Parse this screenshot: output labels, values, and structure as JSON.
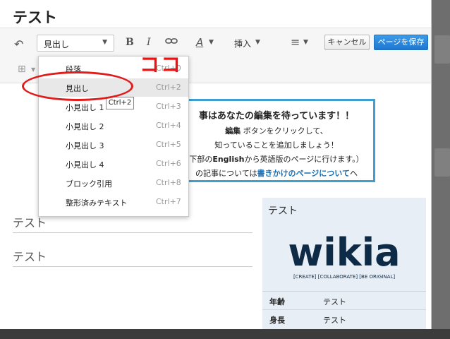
{
  "page": {
    "title": "テスト"
  },
  "toolbar": {
    "format_value": "見出し",
    "insert_label": "挿入",
    "cancel_label": "キャンセル",
    "save_label": "ページを保存"
  },
  "format_menu": {
    "items": [
      {
        "label": "段落",
        "shortcut": "Ctrl+0"
      },
      {
        "label": "見出し",
        "shortcut": "Ctrl+2"
      },
      {
        "label": "小見出し 1",
        "shortcut": "Ctrl+3"
      },
      {
        "label": "小見出し 2",
        "shortcut": "Ctrl+4"
      },
      {
        "label": "小見出し 3",
        "shortcut": "Ctrl+5"
      },
      {
        "label": "小見出し 4",
        "shortcut": "Ctrl+6"
      },
      {
        "label": "ブロック引用",
        "shortcut": "Ctrl+8"
      },
      {
        "label": "整形済みテキスト",
        "shortcut": "Ctrl+7"
      }
    ],
    "selected": "見出し",
    "tooltip": "Ctrl+2"
  },
  "annotation": {
    "text": "ココ",
    "color": "#ee1111"
  },
  "notice": {
    "line1": "事はあなたの編集を待っています！！",
    "line2_bold": "編集",
    "line2_rest": "ボタンをクリックして、",
    "line3": "知っていることを追加しましょう！",
    "line4_pre": "下部の",
    "line4_bold": "English",
    "line4_post": "から英語版のページに行けます。）",
    "line5_pre": "の記事については",
    "line5_link": "書きかけのページについて",
    "line5_post": "へ",
    "border_color": "#3fa0d0"
  },
  "content": {
    "heading1": "テスト",
    "heading2": "テスト"
  },
  "infobox": {
    "title": "テスト",
    "logo_text": "wikia",
    "logo_tagline": "[CREATE] [COLLABORATE] [BE ORIGINAL]",
    "rows": [
      {
        "key": "年齢",
        "value": "テスト"
      },
      {
        "key": "身長",
        "value": "テスト"
      }
    ]
  },
  "colors": {
    "save_button": "#2a86dc",
    "logo": "#0d2a47",
    "infobox_bg": "#e8eef5"
  }
}
